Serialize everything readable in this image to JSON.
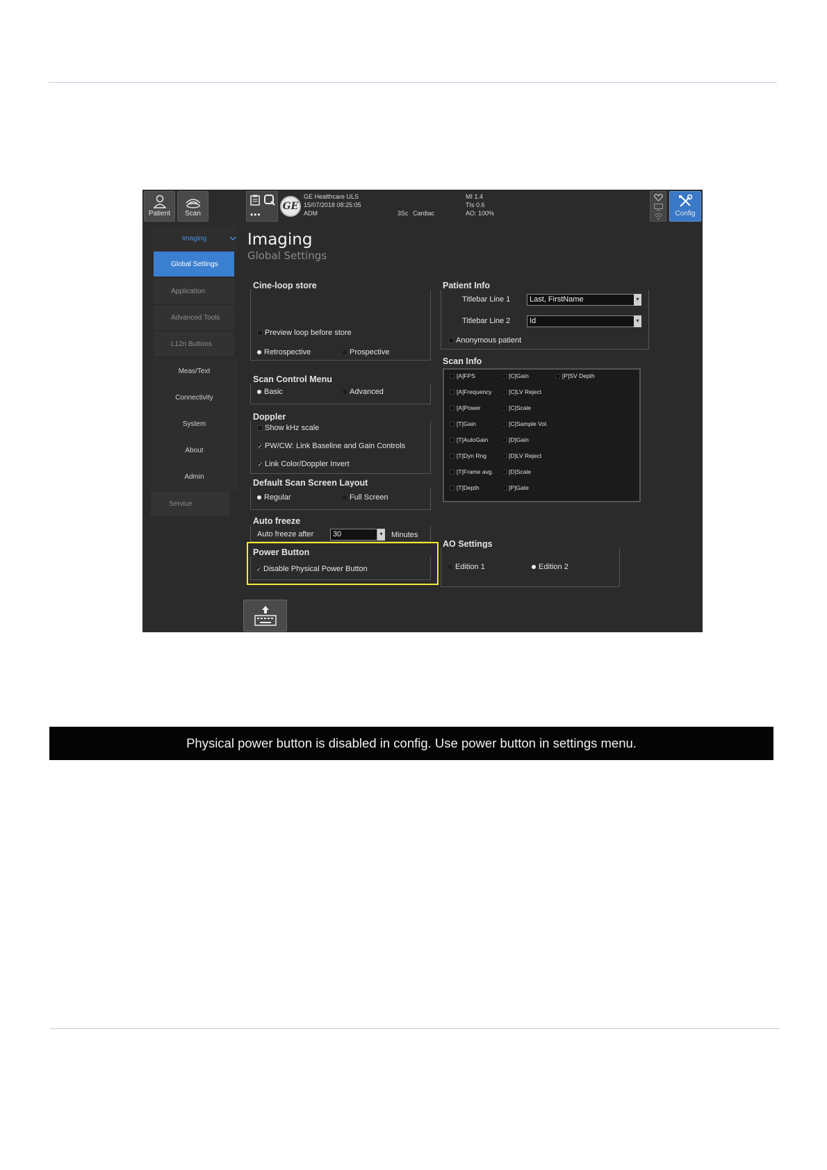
{
  "topbar": {
    "patient_label": "Patient",
    "scan_label": "Scan",
    "config_label": "Config",
    "more_label": "•••",
    "institution": "GE Healthcare ULS",
    "datetime": "15/07/2018 08:25:05",
    "operator": "ADM",
    "probe": "3Sc",
    "application": "Cardiac",
    "mi": "MI 1.4",
    "tis": "TIs 0.6",
    "ao": "AO: 100%"
  },
  "sidebar": {
    "imaging": "Imaging",
    "sub_items": [
      "Global Settings",
      "Application",
      "Advanced Tools",
      "L12n Buttons"
    ],
    "items": [
      "Meas/Text",
      "Connectivity",
      "System",
      "About",
      "Admin"
    ],
    "service": "Service"
  },
  "page": {
    "title": "Imaging",
    "subtitle": "Global Settings"
  },
  "cineloop": {
    "title": "Cine-loop store",
    "preview": "Preview loop before store",
    "retrospective": "Retrospective",
    "prospective": "Prospective"
  },
  "scan_control": {
    "title": "Scan Control Menu",
    "basic": "Basic",
    "advanced": "Advanced"
  },
  "doppler": {
    "title": "Doppler",
    "khz": "Show kHz scale",
    "link_baseline": "PW/CW: Link Baseline and Gain Controls",
    "link_color": "Link Color/Doppler Invert"
  },
  "layout": {
    "title": "Default Scan Screen Layout",
    "regular": "Regular",
    "full": "Full Screen"
  },
  "autofreeze": {
    "title": "Auto freeze",
    "label": "Auto freeze after",
    "value": "30",
    "unit": "Minutes"
  },
  "power": {
    "title": "Power Button",
    "disable": "Disable Physical Power Button"
  },
  "patient_info": {
    "title": "Patient Info",
    "line1_label": "Titlebar Line 1",
    "line1_value": "Last, FirstName",
    "line2_label": "Titlebar Line 2",
    "line2_value": "Id",
    "anonymous": "Anonymous patient"
  },
  "scan_info": {
    "title": "Scan Info",
    "col1": [
      "[A]FPS",
      "[A]Frequency",
      "[A]Power",
      "[T]Gain",
      "[T]AutoGain",
      "[T]Dyn Rng",
      "[T]Frame avg.",
      "[T]Depth"
    ],
    "col2": [
      "[C]Gain",
      "[C]LV Reject",
      "[C]Scale",
      "[C]Sample Vol.",
      "[D]Gain",
      "[D]LV Reject",
      "[D]Scale",
      "[P]Gate"
    ],
    "col3": [
      "[P]SV Depth"
    ]
  },
  "ao_settings": {
    "title": "AO Settings",
    "edition1": "Edition 1",
    "edition2": "Edition 2"
  },
  "banner": {
    "text": "Physical power button is disabled in config. Use power button in settings menu."
  },
  "colors": {
    "accent": "#3b7fd0",
    "highlight": "#f2ea2f",
    "panel": "#2b2b2b"
  }
}
